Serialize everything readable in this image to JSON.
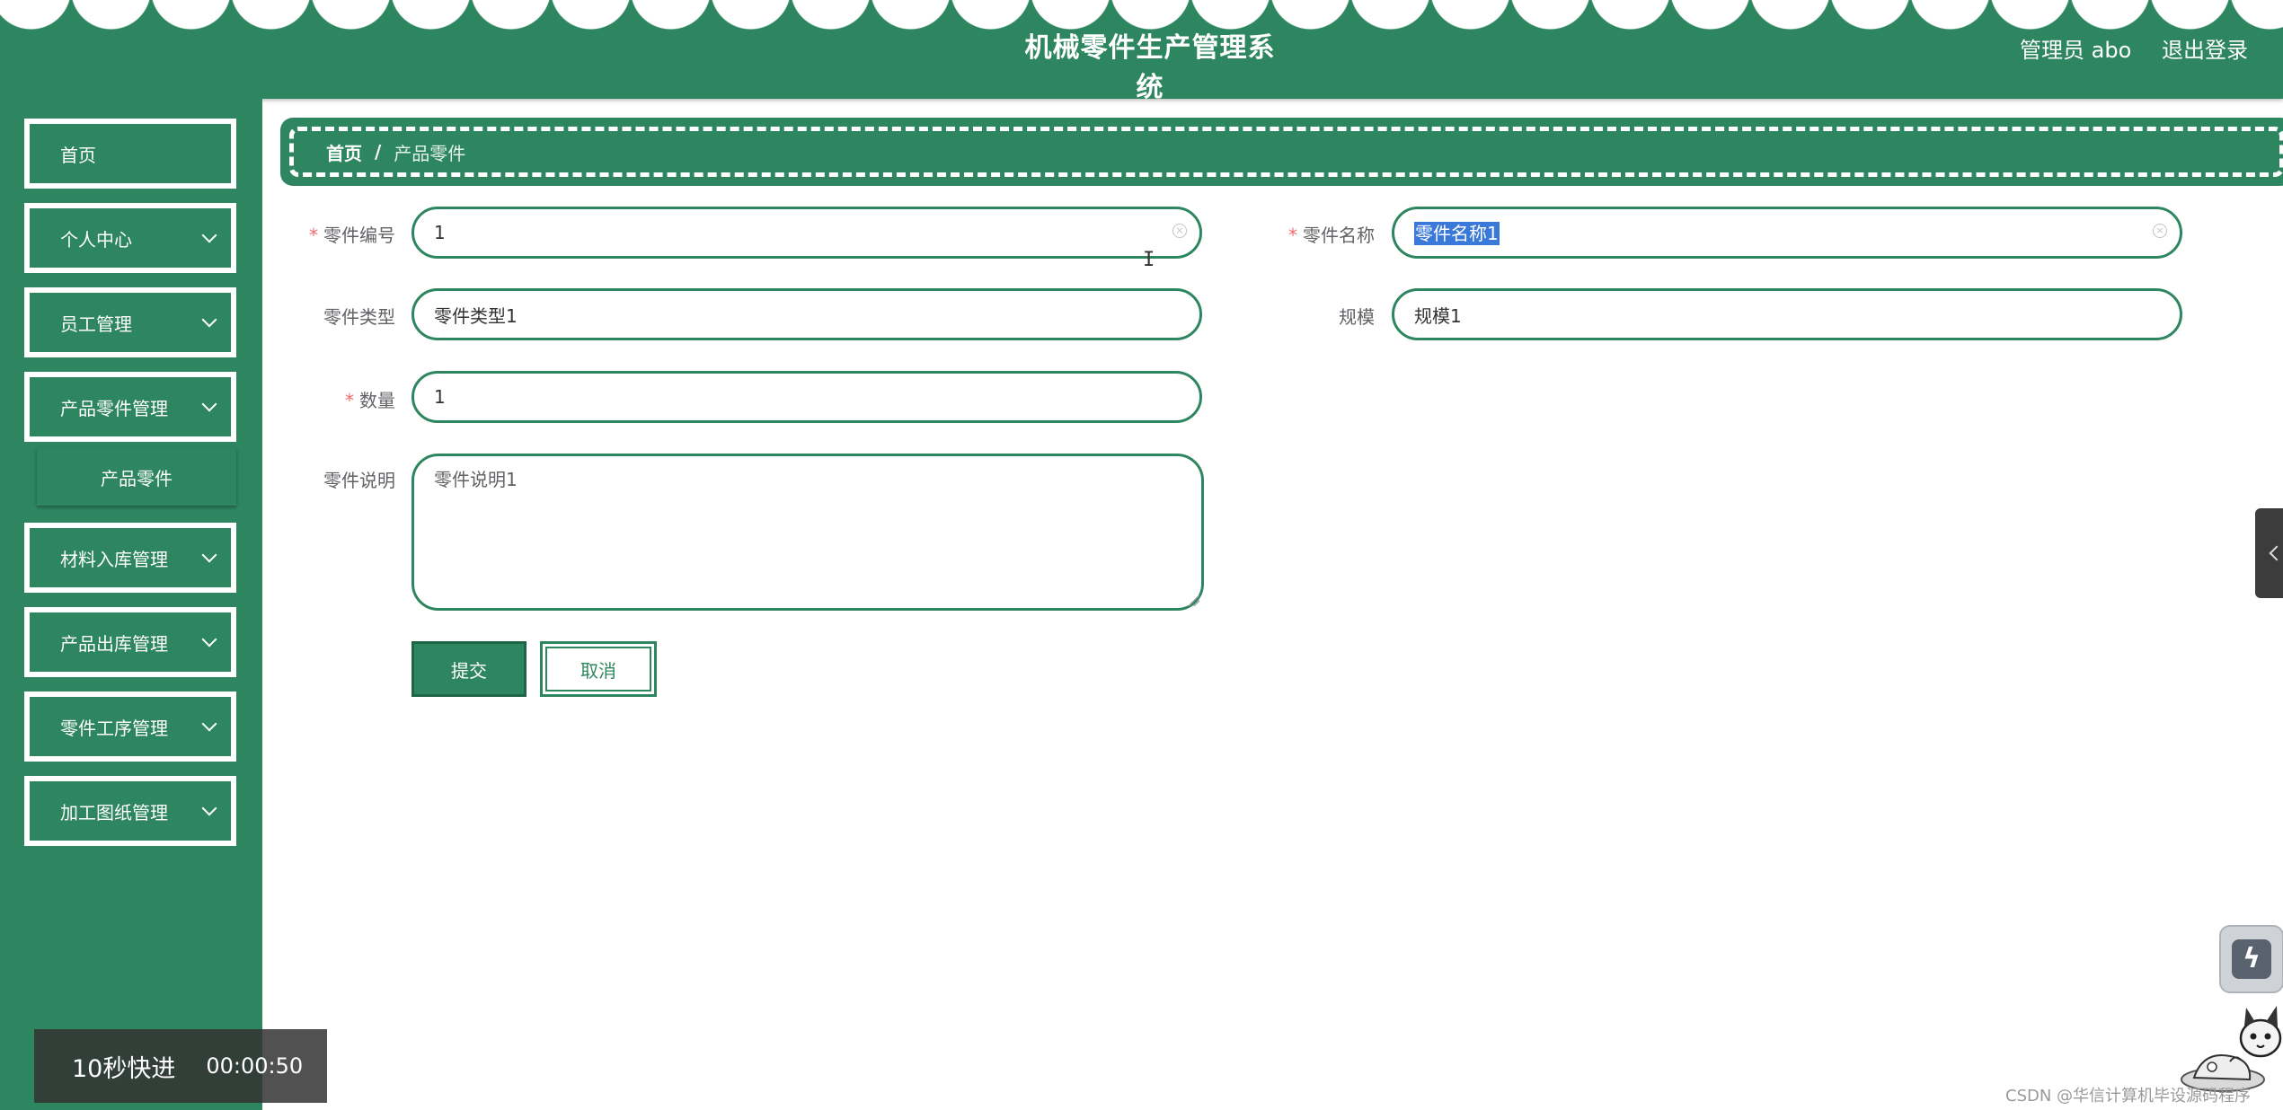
{
  "header": {
    "title": "机械零件生产管理系统",
    "user": "管理员 abo",
    "logout": "退出登录"
  },
  "sidebar": {
    "items": [
      {
        "label": "首页",
        "expandable": false
      },
      {
        "label": "个人中心",
        "expandable": true
      },
      {
        "label": "员工管理",
        "expandable": true
      },
      {
        "label": "产品零件管理",
        "expandable": true
      },
      {
        "label": "材料入库管理",
        "expandable": true
      },
      {
        "label": "产品出库管理",
        "expandable": true
      },
      {
        "label": "零件工序管理",
        "expandable": true
      },
      {
        "label": "加工图纸管理",
        "expandable": true
      }
    ],
    "submenu": {
      "label": "产品零件"
    }
  },
  "breadcrumb": {
    "home": "首页",
    "separator": "/",
    "current": "产品零件"
  },
  "form": {
    "part_no": {
      "label": "零件编号",
      "required": true,
      "value": "1"
    },
    "part_name": {
      "label": "零件名称",
      "required": true,
      "value": "零件名称1"
    },
    "part_type": {
      "label": "零件类型",
      "required": false,
      "value": "零件类型1"
    },
    "scale": {
      "label": "规模",
      "required": false,
      "value": "规模1"
    },
    "quantity": {
      "label": "数量",
      "required": true,
      "value": "1"
    },
    "description": {
      "label": "零件说明",
      "required": false,
      "value": "零件说明1"
    },
    "required_mark": "*",
    "submit": "提交",
    "cancel": "取消"
  },
  "overlay": {
    "fast_forward": "10秒快进",
    "time": "00:00:50",
    "watermark": "CSDN @华信计算机毕设源码程序"
  },
  "colors": {
    "primary": "#2e8660",
    "required": "#f56c6c",
    "selection": "#3a78d9"
  }
}
